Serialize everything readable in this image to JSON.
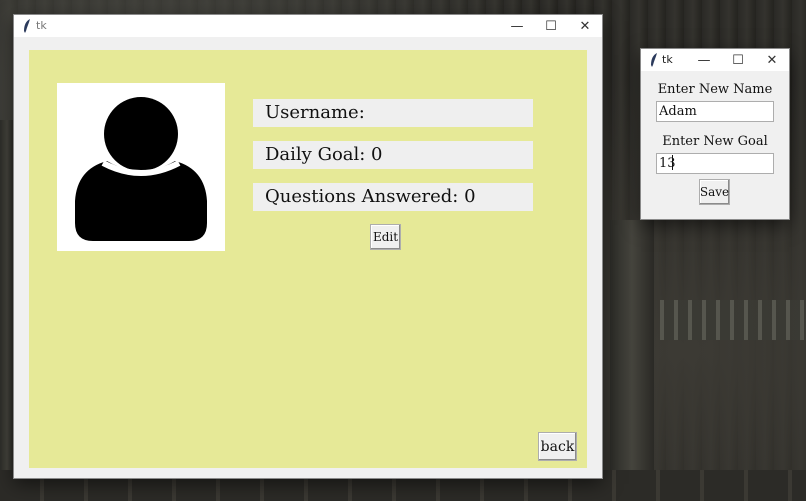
{
  "main_window": {
    "title": "tk",
    "minimize_glyph": "—",
    "maximize_glyph": "☐",
    "close_glyph": "✕",
    "username_label": "Username:",
    "daily_goal_label": "Daily Goal: 0",
    "questions_label": "Questions Answered: 0",
    "edit_label": "Edit",
    "back_label": "back",
    "avatar_icon": "user-silhouette-icon",
    "canvas_color": "#e6e997"
  },
  "popup_window": {
    "title": "tk",
    "minimize_glyph": "—",
    "maximize_glyph": "☐",
    "close_glyph": "✕",
    "name_label": "Enter New Name",
    "name_value": "Adam",
    "goal_label": "Enter New Goal",
    "goal_value": "13",
    "save_label": "Save"
  }
}
